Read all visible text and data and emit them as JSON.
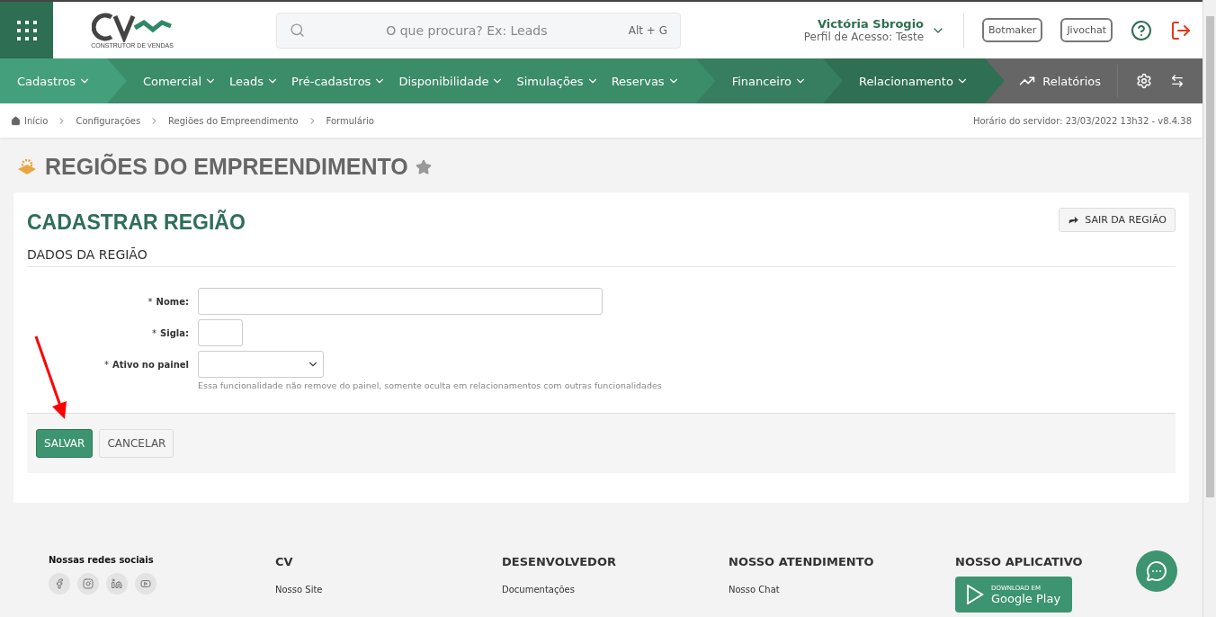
{
  "header": {
    "logo_caption": "CONSTRUTOR DE VENDAS",
    "search": {
      "placeholder": "O que procura? Ex: Leads",
      "shortcut": "Alt + G"
    },
    "user": {
      "name": "Victória Sbrogio",
      "profile": "Perfil de Acesso: Teste"
    },
    "buttons": [
      "Botmaker",
      "Jivochat"
    ]
  },
  "nav": {
    "groups": [
      {
        "color": "#44a07c",
        "items": [
          "Cadastros"
        ]
      },
      {
        "color": "#3b8c69",
        "items": [
          "Comercial",
          "Leads",
          "Pré-cadastros",
          "Disponibilidade",
          "Simulações",
          "Reservas"
        ]
      },
      {
        "color": "#367e5f",
        "items": [
          "Financeiro"
        ]
      },
      {
        "color": "#2f6f53",
        "items": [
          "Relacionamento"
        ]
      }
    ],
    "reports": "Relatórios"
  },
  "breadcrumb": [
    "Início",
    "Configurações",
    "Regiões do Empreendimento",
    "Formulário"
  ],
  "server_time": "Horário do servidor: 23/03/2022 13h32 - v8.4.38",
  "page_title": "REGIÕES DO EMPREENDIMENTO",
  "favorite": false,
  "form": {
    "title": "CADASTRAR REGIÃO",
    "required_mark": "*",
    "exit_button": "SAIR DA REGIÃO",
    "section": "DADOS DA REGIÃO",
    "fields": [
      {
        "kind": "text",
        "label": "Nome:",
        "required": true
      },
      {
        "kind": "short",
        "label": "Sigla:",
        "required": true
      },
      {
        "kind": "select",
        "label": "Ativo no painel",
        "required": true,
        "hint": "Essa funcionalidade não remove do painel, somente oculta em relacionamentos com outras funcionalidades"
      }
    ],
    "buttons": [
      {
        "kind": "primary",
        "label": "SALVAR"
      },
      {
        "kind": "default",
        "label": "CANCELAR"
      }
    ]
  },
  "footer": {
    "social_title": "Nossas redes sociais",
    "columns": [
      {
        "title": "CV",
        "links": [
          "Nosso Site"
        ]
      },
      {
        "title": "DESENVOLVEDOR",
        "links": [
          "Documentações"
        ]
      },
      {
        "title": "NOSSO ATENDIMENTO",
        "links": [
          "Nosso Chat"
        ]
      },
      {
        "title": "NOSSO APLICATIVO",
        "badge": {
          "small": "DOWNLOAD EM",
          "big": "Google Play"
        }
      }
    ]
  }
}
